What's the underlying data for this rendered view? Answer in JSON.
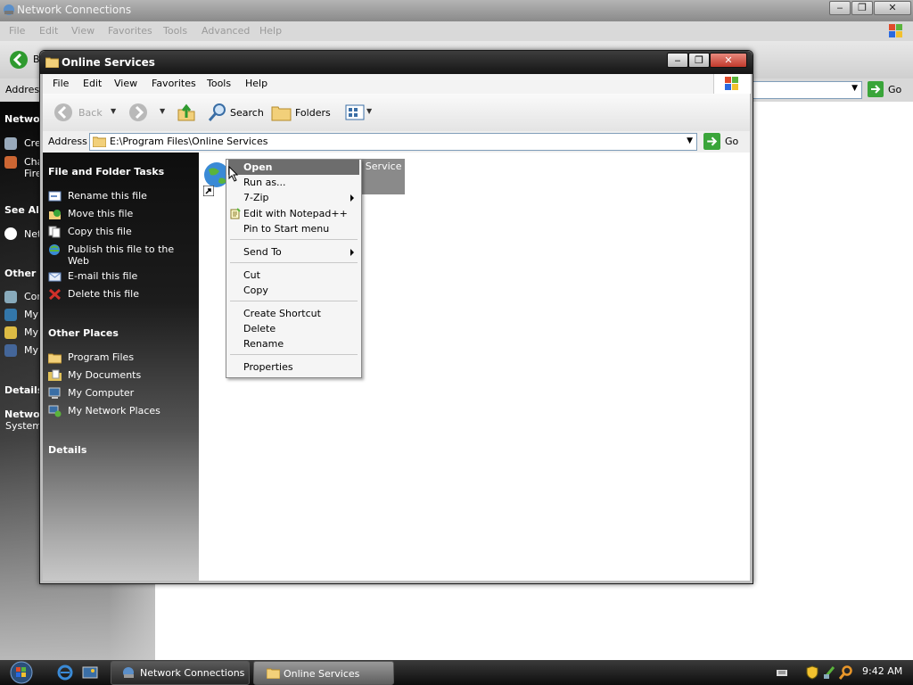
{
  "background_window": {
    "title": "Network Connections",
    "menu": [
      "File",
      "Edit",
      "View",
      "Favorites",
      "Tools",
      "Advanced",
      "Help"
    ],
    "address_label": "Address",
    "go_label": "Go",
    "back_label": "B",
    "sidebar": {
      "network_tasks_title": "Networ",
      "task1": "Cre",
      "task2_line1": "Cha",
      "task2_line2": "Fire",
      "see_also_title": "See Als",
      "see_also_item": "Net",
      "other_places_title": "Other P",
      "op1": "Cor",
      "op2": "My",
      "op3": "My",
      "op4": "My",
      "details_title": "Details",
      "details_line1": "Networ",
      "details_line2": "System"
    }
  },
  "window": {
    "title": "Online Services",
    "menu": {
      "file": "File",
      "edit": "Edit",
      "view": "View",
      "favorites": "Favorites",
      "tools": "Tools",
      "help": "Help"
    },
    "toolbar": {
      "back": "Back",
      "search": "Search",
      "folders": "Folders"
    },
    "address": {
      "label": "Address",
      "path": "E:\\Program Files\\Online Services",
      "go": "Go"
    },
    "tasks": {
      "file_folder_title": "File and Folder Tasks",
      "items": [
        "Rename this file",
        "Move this file",
        "Copy this file",
        "Publish this file to the",
        "Web",
        "E-mail this file",
        "Delete this file"
      ]
    },
    "other_places": {
      "title": "Other Places",
      "items": [
        "Program Files",
        "My Documents",
        "My Computer",
        "My Network Places"
      ]
    },
    "details_title": "Details"
  },
  "file_item": {
    "label_visible": "t Service"
  },
  "context_menu": {
    "items": [
      "Open",
      "Run as...",
      "7-Zip",
      "Edit with Notepad++",
      "Pin to Start menu",
      "Send To",
      "Cut",
      "Copy",
      "Create Shortcut",
      "Delete",
      "Rename",
      "Properties"
    ]
  },
  "taskbar": {
    "buttons": [
      "Network Connections",
      "Online Services"
    ],
    "clock": "9:42 AM"
  },
  "colors": {
    "accent": "#6d6d6d",
    "go_green": "#3aa53a",
    "title_dark": "#151515"
  }
}
